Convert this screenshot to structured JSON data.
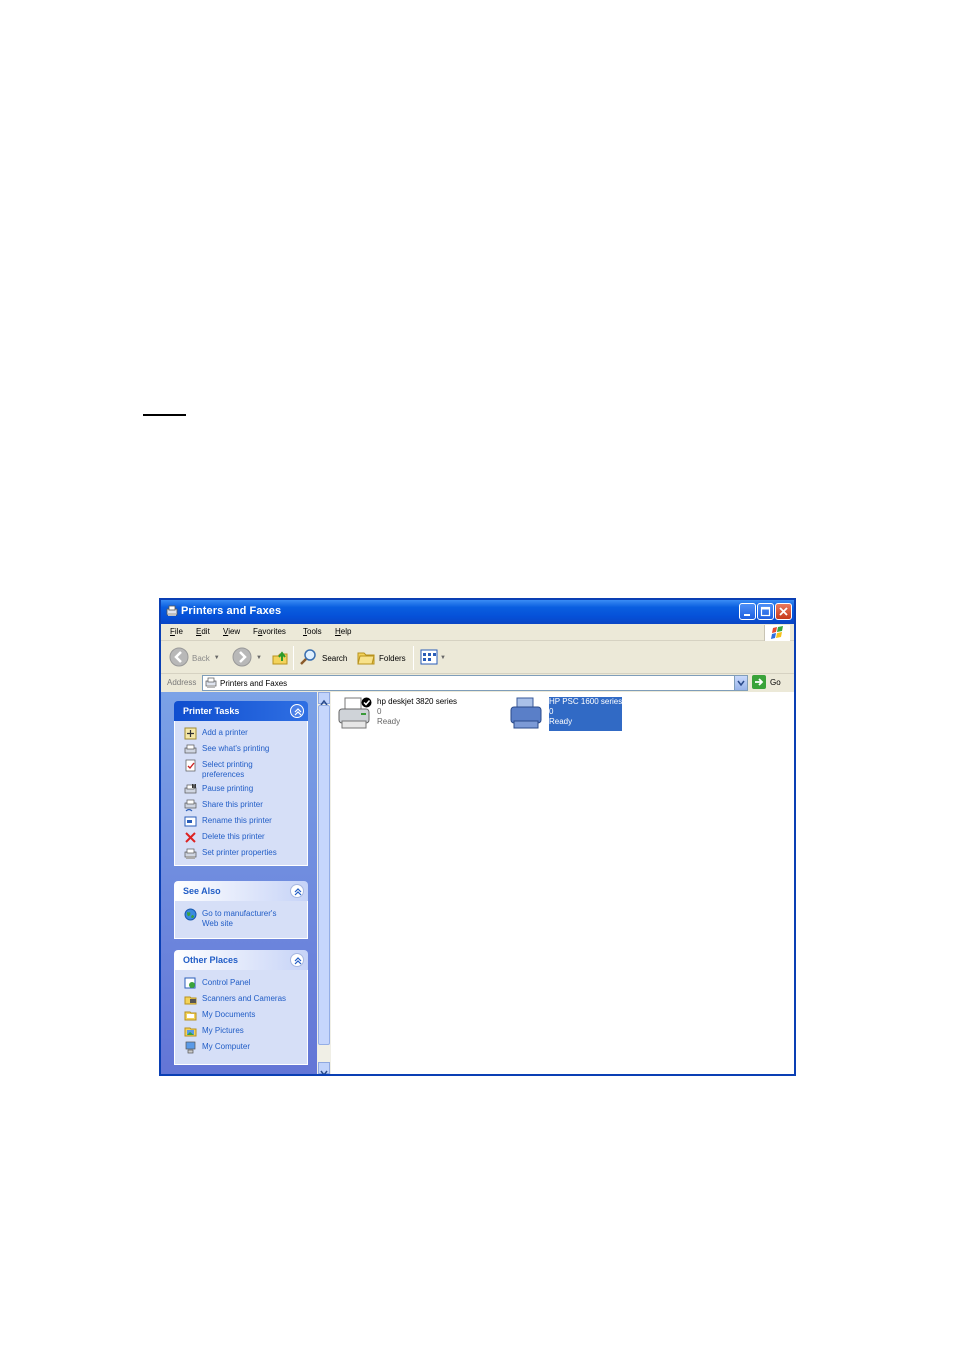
{
  "window": {
    "title": "Printers and Faxes"
  },
  "menu": [
    "File",
    "Edit",
    "View",
    "Favorites",
    "Tools",
    "Help"
  ],
  "menu_underline": [
    "F",
    "E",
    "V",
    "a",
    "T",
    "H"
  ],
  "toolbar": {
    "back_label": "Back",
    "search_label": "Search",
    "folders_label": "Folders"
  },
  "address": {
    "label": "Address",
    "value": "Printers and Faxes",
    "go_label": "Go"
  },
  "printer_tasks": {
    "title": "Printer Tasks",
    "items": [
      {
        "label": "Add a printer",
        "icon": "add-printer-icon"
      },
      {
        "label": "See what's printing",
        "icon": "printer-queue-icon"
      },
      {
        "label": "Select printing preferences",
        "icon": "preferences-icon"
      },
      {
        "label": "Pause printing",
        "icon": "pause-printer-icon"
      },
      {
        "label": "Share this printer",
        "icon": "share-printer-icon"
      },
      {
        "label": "Rename this printer",
        "icon": "rename-icon"
      },
      {
        "label": "Delete this printer",
        "icon": "delete-icon"
      },
      {
        "label": "Set printer properties",
        "icon": "properties-icon"
      }
    ]
  },
  "see_also": {
    "title": "See Also",
    "items": [
      {
        "label": "Go to manufacturer's Web site",
        "icon": "globe-icon"
      }
    ]
  },
  "other_places": {
    "title": "Other Places",
    "items": [
      {
        "label": "Control Panel",
        "icon": "control-panel-icon"
      },
      {
        "label": "Scanners and Cameras",
        "icon": "scanner-icon"
      },
      {
        "label": "My Documents",
        "icon": "folder-icon"
      },
      {
        "label": "My Pictures",
        "icon": "pictures-icon"
      },
      {
        "label": "My Computer",
        "icon": "computer-icon"
      }
    ]
  },
  "printers": [
    {
      "name": "hp deskjet 3820 series",
      "jobs": "0",
      "status": "Ready",
      "is_default": true,
      "selected": false
    },
    {
      "name": "HP PSC 1600 series",
      "jobs": "0",
      "status": "Ready",
      "is_default": false,
      "selected": true
    }
  ],
  "colors": {
    "title_blue": "#0550d8",
    "task_pane": "#6375d6",
    "link_blue": "#215dc6",
    "selection": "#316ac5"
  }
}
